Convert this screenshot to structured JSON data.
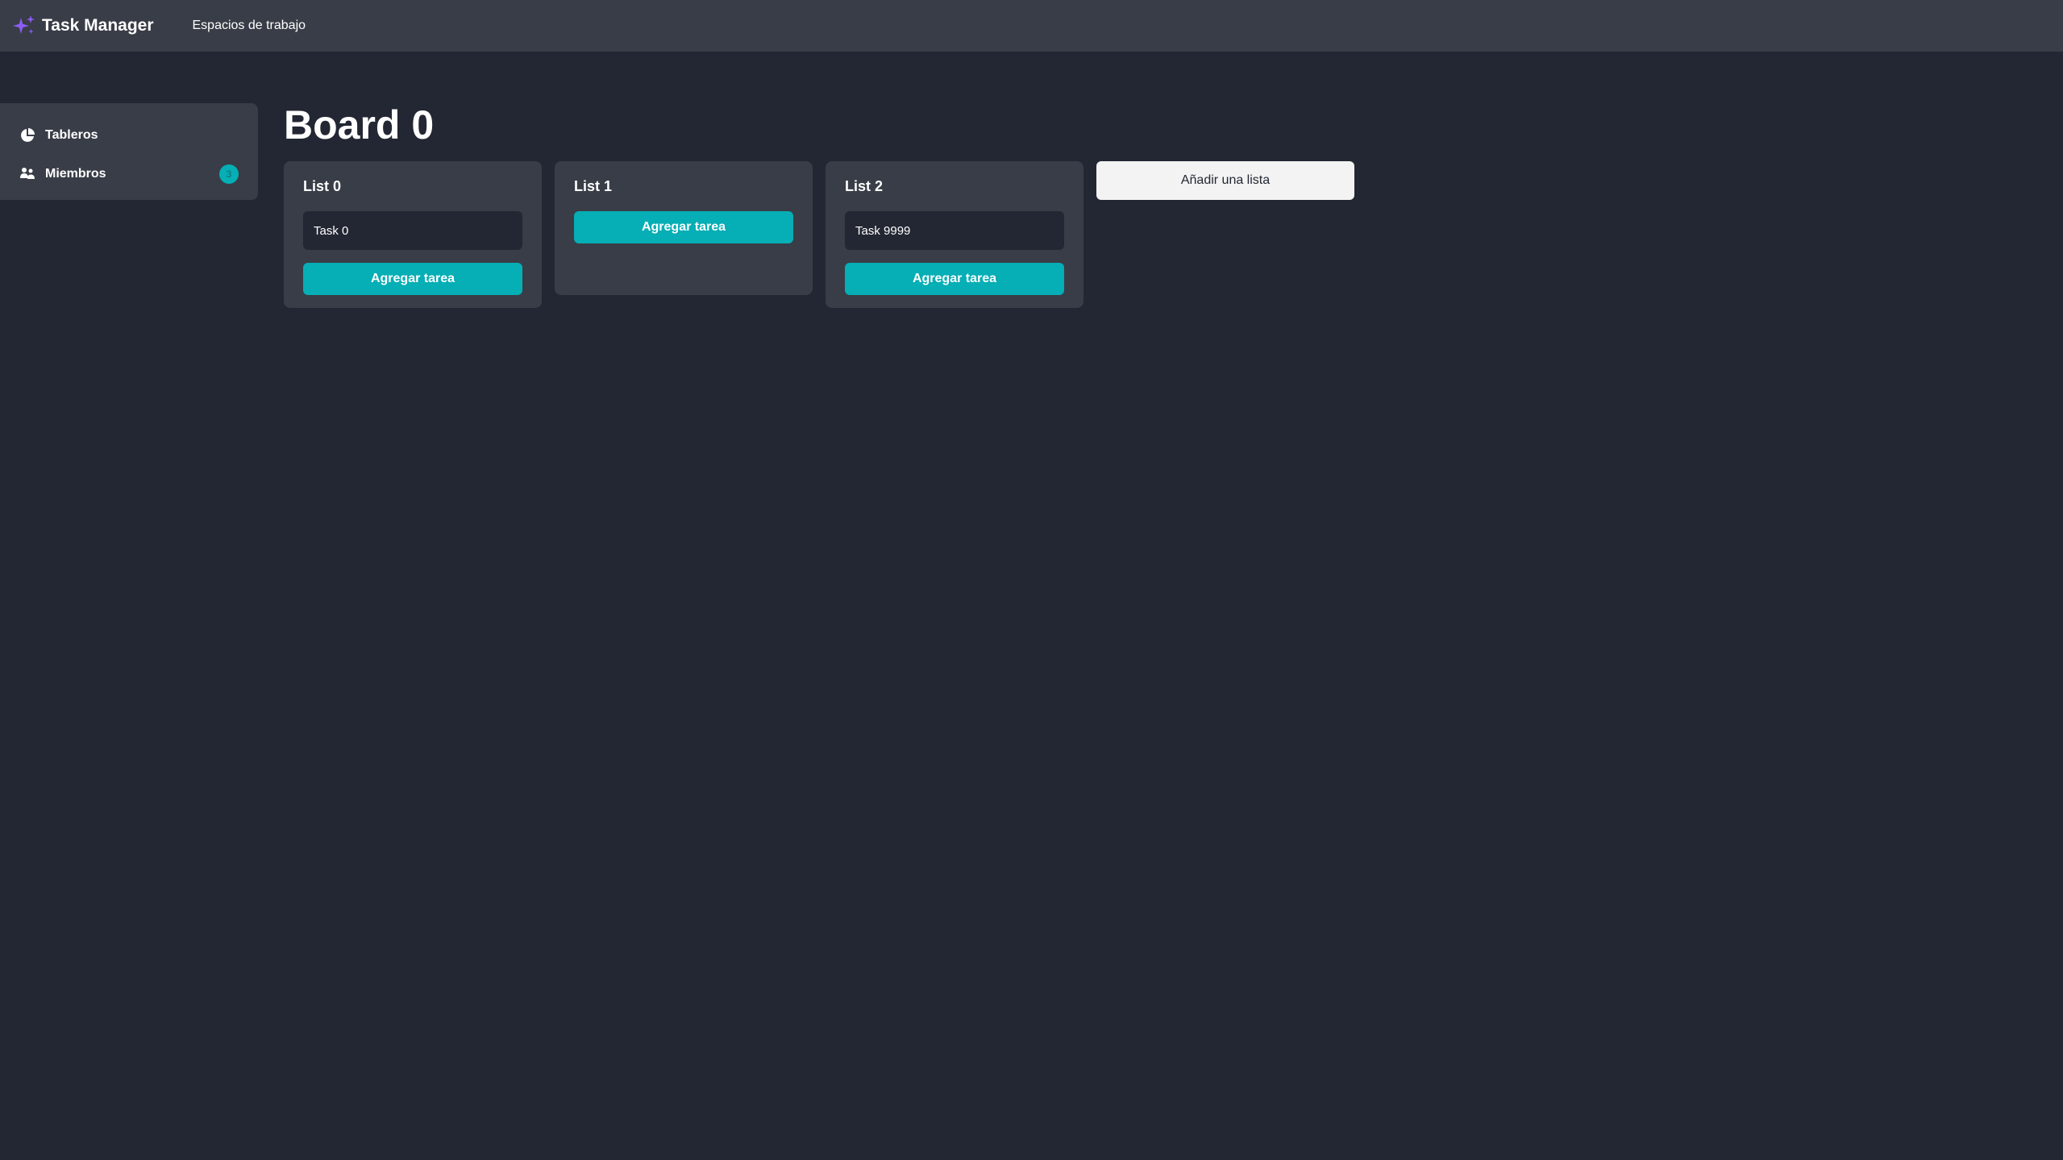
{
  "header": {
    "app_title": "Task Manager",
    "nav_workspaces": "Espacios de trabajo",
    "logo_icon": "sparkle-icon",
    "logo_color": "#8b5cf6"
  },
  "sidebar": {
    "items": [
      {
        "label": "Tableros",
        "icon": "boards-icon"
      },
      {
        "label": "Miembros",
        "icon": "members-icon",
        "badge": "3"
      }
    ]
  },
  "board": {
    "title": "Board 0",
    "lists": [
      {
        "title": "List 0",
        "tasks": [
          "Task 0"
        ],
        "add_task_label": "Agregar tarea"
      },
      {
        "title": "List 1",
        "tasks": [],
        "add_task_label": "Agregar tarea"
      },
      {
        "title": "List 2",
        "tasks": [
          "Task 9999"
        ],
        "add_task_label": "Agregar tarea"
      }
    ],
    "add_list_label": "Añadir una lista"
  },
  "colors": {
    "background": "#232733",
    "surface": "#383d47",
    "accent": "#06aeb5"
  }
}
